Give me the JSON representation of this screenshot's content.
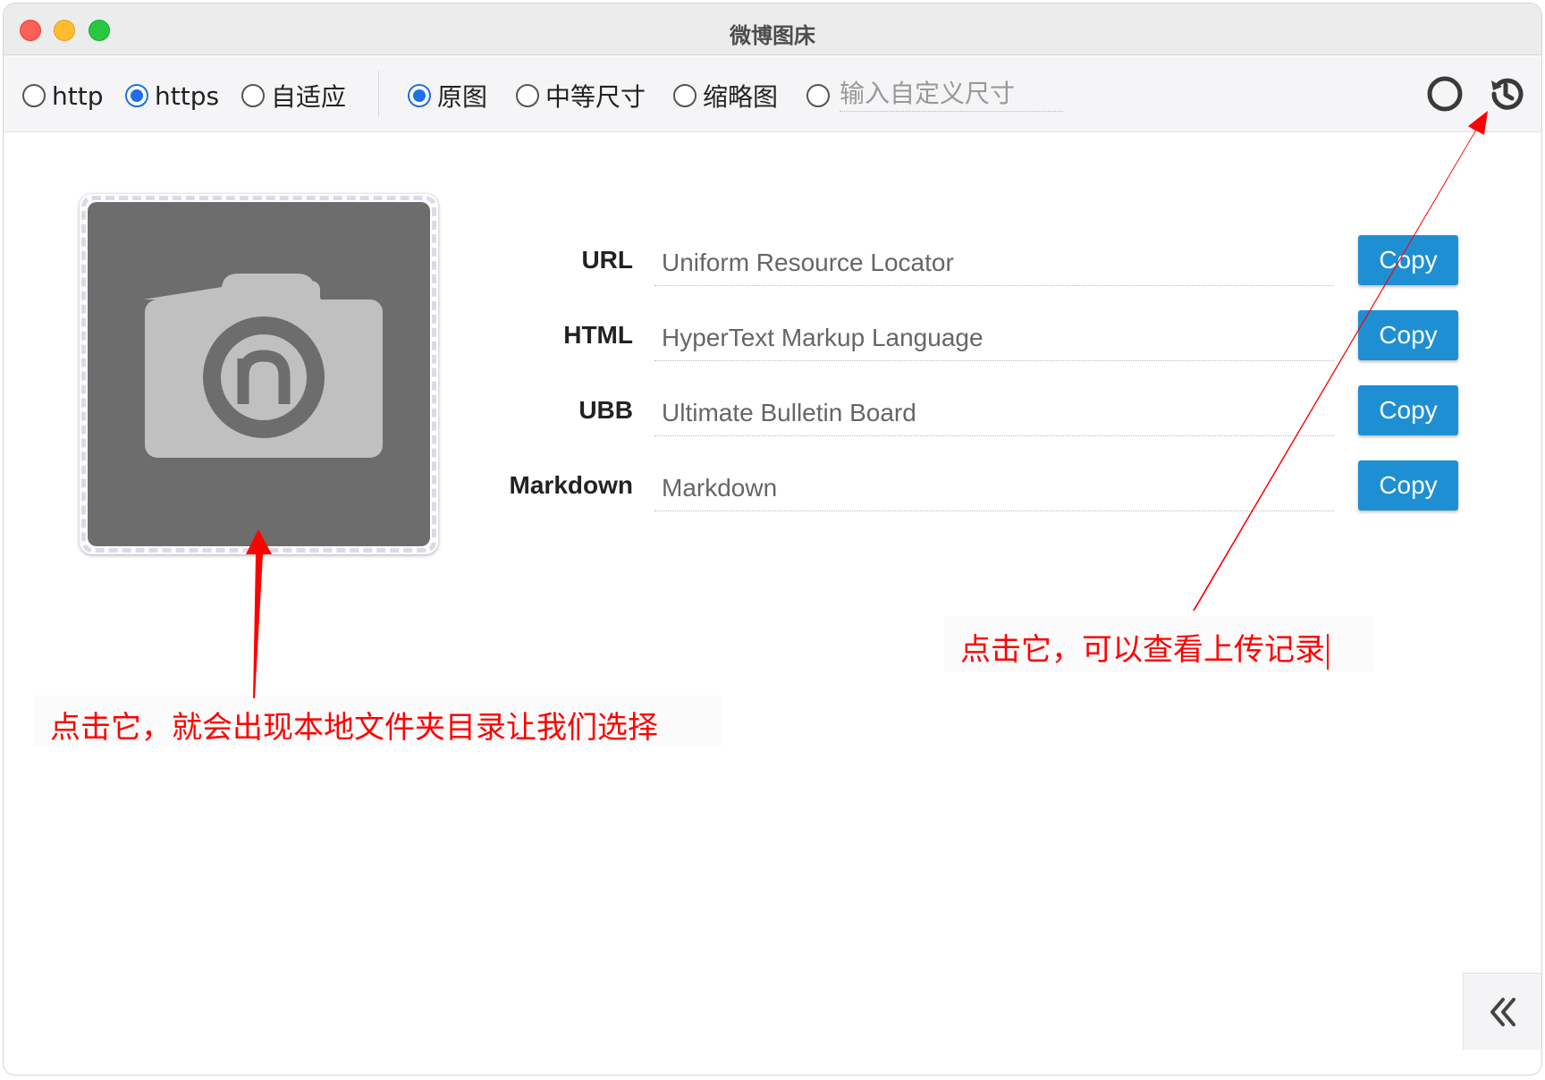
{
  "window": {
    "title": "微博图床"
  },
  "toolbar": {
    "protocol_options": [
      {
        "label": "http",
        "selected": false
      },
      {
        "label": "https",
        "selected": true
      },
      {
        "label": "自适应",
        "selected": false
      }
    ],
    "size_options": [
      {
        "label": "原图",
        "selected": true
      },
      {
        "label": "中等尺寸",
        "selected": false
      },
      {
        "label": "缩略图",
        "selected": false
      },
      {
        "label": "",
        "selected": false
      }
    ],
    "custom_size_placeholder": "输入自定义尺寸",
    "icons": {
      "status": "circle-icon",
      "history": "history-icon"
    }
  },
  "upload": {
    "icon": "camera-icon"
  },
  "links": [
    {
      "label": "URL",
      "placeholder": "Uniform Resource Locator",
      "button": "Copy"
    },
    {
      "label": "HTML",
      "placeholder": "HyperText Markup Language",
      "button": "Copy"
    },
    {
      "label": "UBB",
      "placeholder": "Ultimate Bulletin Board",
      "button": "Copy"
    },
    {
      "label": "Markdown",
      "placeholder": "Markdown",
      "button": "Copy"
    }
  ],
  "annotations": {
    "upload_hint": "点击它，就会出现本地文件夹目录让我们选择",
    "history_hint": "点击它，可以查看上传记录"
  },
  "colors": {
    "accent": "#1f6fe5",
    "copy_button": "#1f8fd3",
    "annotation": "#ff0000"
  },
  "collapse": {
    "icon": "double-chevron-left-icon"
  }
}
